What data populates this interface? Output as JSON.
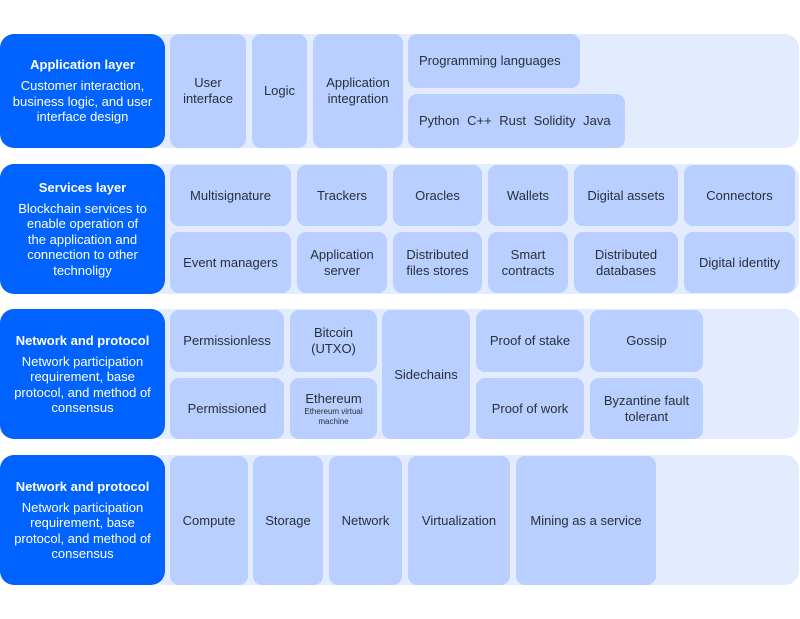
{
  "colors": {
    "layer": "#0062ff",
    "cell": "#b8cfff",
    "band": "#e3ecff"
  },
  "layers": [
    {
      "title": "Application layer",
      "description": "Customer interaction, business logic, and user interface design",
      "cells": {
        "user_interface": "User interface",
        "logic": "Logic",
        "application_integration": "Application integration",
        "programming_languages": "Programming languages",
        "languages_list": "Python C++ Rust Solidity Java"
      }
    },
    {
      "title": "Services layer",
      "description": "Blockchain services to enable operation of the application and connection to other technoligy",
      "cells": {
        "multisignature": "Multisignature",
        "trackers": "Trackers",
        "oracles": "Oracles",
        "wallets": "Wallets",
        "digital_assets": "Digital assets",
        "connectors": "Connectors",
        "event_managers": "Event managers",
        "application_server": "Application server",
        "distributed_files_stores": "Distributed files stores",
        "smart_contracts": "Smart contracts",
        "distributed_databases": "Distributed databases",
        "digital_identity": "Digital identity"
      }
    },
    {
      "title": "Network and protocol",
      "description": "Network participation requirement, base protocol, and method of consensus",
      "cells": {
        "permissionless": "Permissionless",
        "bitcoin": "Bitcoin (UTXO)",
        "sidechains": "Sidechains",
        "proof_of_stake": "Proof of stake",
        "gossip": "Gossip",
        "permissioned": "Permissioned",
        "ethereum": "Ethereum",
        "ethereum_sub": "Ethereum virtual machine",
        "proof_of_work": "Proof of work",
        "byzantine": "Byzantine fault tolerant"
      }
    },
    {
      "title": "Network and protocol",
      "description": "Network participation requirement, base protocol, and method of consensus",
      "cells": {
        "compute": "Compute",
        "storage": "Storage",
        "network": "Network",
        "virtualization": "Virtualization",
        "mining": "Mining as a service"
      }
    }
  ]
}
